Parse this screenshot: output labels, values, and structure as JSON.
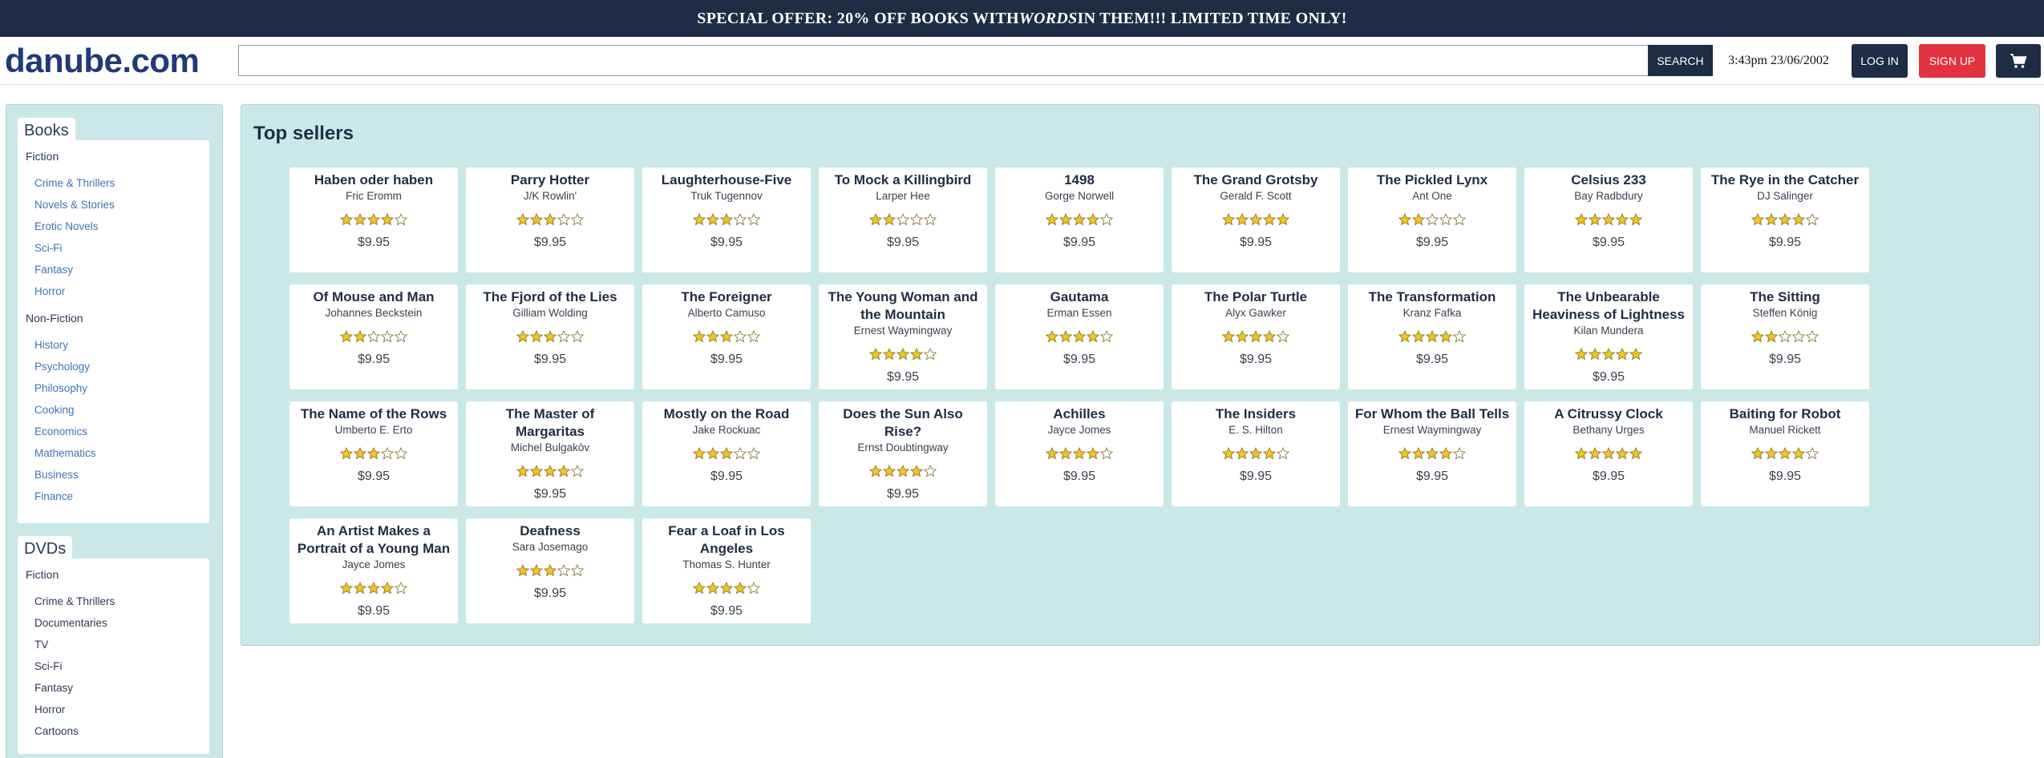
{
  "banner": {
    "before": "SPECIAL OFFER: 20% OFF BOOKS WITH ",
    "emphasis": "WORDS",
    "after": " IN THEM!!! LIMITED TIME ONLY!"
  },
  "header": {
    "logo": "danube.com",
    "search_value": "",
    "search_placeholder": "",
    "search_button": "SEARCH",
    "clock": "3:43pm 23/06/2002",
    "login_button": "LOG IN",
    "signup_button": "SIGN UP",
    "cart_icon": "cart-icon"
  },
  "sidebar": {
    "books": {
      "title": "Books",
      "groups": [
        {
          "heading": "Fiction",
          "items": [
            "Crime & Thrillers",
            "Novels & Stories",
            "Erotic Novels",
            "Sci-Fi",
            "Fantasy",
            "Horror"
          ]
        },
        {
          "heading": "Non-Fiction",
          "items": [
            "History",
            "Psychology",
            "Philosophy",
            "Cooking",
            "Economics",
            "Mathematics",
            "Business",
            "Finance"
          ]
        }
      ]
    },
    "dvds": {
      "title": "DVDs",
      "groups": [
        {
          "heading": "Fiction",
          "items": [
            "Crime & Thrillers",
            "Documentaries",
            "TV",
            "Sci-Fi",
            "Fantasy",
            "Horror",
            "Cartoons"
          ]
        }
      ]
    }
  },
  "main": {
    "title": "Top sellers",
    "colors": {
      "star_fill": "#f5c518",
      "star_empty": "#ffffff",
      "star_stroke": "#8a7a3a"
    },
    "books": [
      {
        "title": "Haben oder haben",
        "author": "Fric Eromm",
        "rating": 4,
        "price": "$9.95"
      },
      {
        "title": "Parry Hotter",
        "author": "J/K Rowlin'",
        "rating": 3,
        "price": "$9.95"
      },
      {
        "title": "Laughterhouse-Five",
        "author": "Truk Tugennov",
        "rating": 3,
        "price": "$9.95"
      },
      {
        "title": "To Mock a Killingbird",
        "author": "Larper Hee",
        "rating": 2,
        "price": "$9.95"
      },
      {
        "title": "1498",
        "author": "Gorge Norwell",
        "rating": 4,
        "price": "$9.95"
      },
      {
        "title": "The Grand Grotsby",
        "author": "Gerald F. Scott",
        "rating": 5,
        "price": "$9.95"
      },
      {
        "title": "The Pickled Lynx",
        "author": "Ant One",
        "rating": 2,
        "price": "$9.95"
      },
      {
        "title": "Celsius 233",
        "author": "Bay Radbdury",
        "rating": 5,
        "price": "$9.95"
      },
      {
        "title": "The Rye in the Catcher",
        "author": "DJ Salinger",
        "rating": 4,
        "price": "$9.95"
      },
      {
        "title": "Of Mouse and Man",
        "author": "Johannes Beckstein",
        "rating": 2,
        "price": "$9.95"
      },
      {
        "title": "The Fjord of the Lies",
        "author": "Gilliam Wolding",
        "rating": 3,
        "price": "$9.95"
      },
      {
        "title": "The Foreigner",
        "author": "Alberto Camuso",
        "rating": 3,
        "price": "$9.95"
      },
      {
        "title": "The Young Woman and the Mountain",
        "author": "Ernest Waymingway",
        "rating": 4,
        "price": "$9.95"
      },
      {
        "title": "Gautama",
        "author": "Erman Essen",
        "rating": 4,
        "price": "$9.95"
      },
      {
        "title": "The Polar Turtle",
        "author": "Alyx Gawker",
        "rating": 4,
        "price": "$9.95"
      },
      {
        "title": "The Transformation",
        "author": "Kranz Fafka",
        "rating": 4,
        "price": "$9.95"
      },
      {
        "title": "The Unbearable Heaviness of Lightness",
        "author": "Kilan Mundera",
        "rating": 5,
        "price": "$9.95"
      },
      {
        "title": "The Sitting",
        "author": "Steffen König",
        "rating": 2,
        "price": "$9.95"
      },
      {
        "title": "The Name of the Rows",
        "author": "Umberto E. Erto",
        "rating": 3,
        "price": "$9.95"
      },
      {
        "title": "The Master of Margaritas",
        "author": "Michel Bulgakòv",
        "rating": 4,
        "price": "$9.95"
      },
      {
        "title": "Mostly on the Road",
        "author": "Jake Rockuac",
        "rating": 3,
        "price": "$9.95"
      },
      {
        "title": "Does the Sun Also Rise?",
        "author": "Ernst Doubtingway",
        "rating": 4,
        "price": "$9.95"
      },
      {
        "title": "Achilles",
        "author": "Jayce Jomes",
        "rating": 4,
        "price": "$9.95"
      },
      {
        "title": "The Insiders",
        "author": "E. S. Hilton",
        "rating": 4,
        "price": "$9.95"
      },
      {
        "title": "For Whom the Ball Tells",
        "author": "Ernest Waymingway",
        "rating": 4,
        "price": "$9.95"
      },
      {
        "title": "A Citrussy Clock",
        "author": "Bethany Urges",
        "rating": 5,
        "price": "$9.95"
      },
      {
        "title": "Baiting for Robot",
        "author": "Manuel Rickett",
        "rating": 4,
        "price": "$9.95"
      },
      {
        "title": "An Artist Makes a Portrait of a Young Man",
        "author": "Jayce Jomes",
        "rating": 4,
        "price": "$9.95"
      },
      {
        "title": "Deafness",
        "author": "Sara Josemago",
        "rating": 3,
        "price": "$9.95"
      },
      {
        "title": "Fear a Loaf in Los Angeles",
        "author": "Thomas S. Hunter",
        "rating": 4,
        "price": "$9.95"
      }
    ]
  }
}
